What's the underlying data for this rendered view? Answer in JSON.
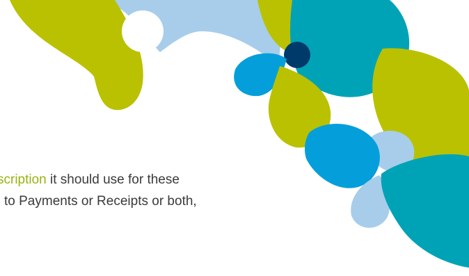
{
  "colors": {
    "background": "#ffffff",
    "lime": "#b9c100",
    "teal": "#00a3b6",
    "sky": "#049fdb",
    "pale_blue": "#a7cdeb",
    "navy": "#003a6b",
    "text": "#3a3a3a",
    "highlight_text": "#9ab211"
  },
  "slide": {
    "line1": {
      "highlight": "scription",
      "rest": " it should use for these"
    },
    "line2": {
      "text": "to Payments or Receipts or both,"
    }
  }
}
